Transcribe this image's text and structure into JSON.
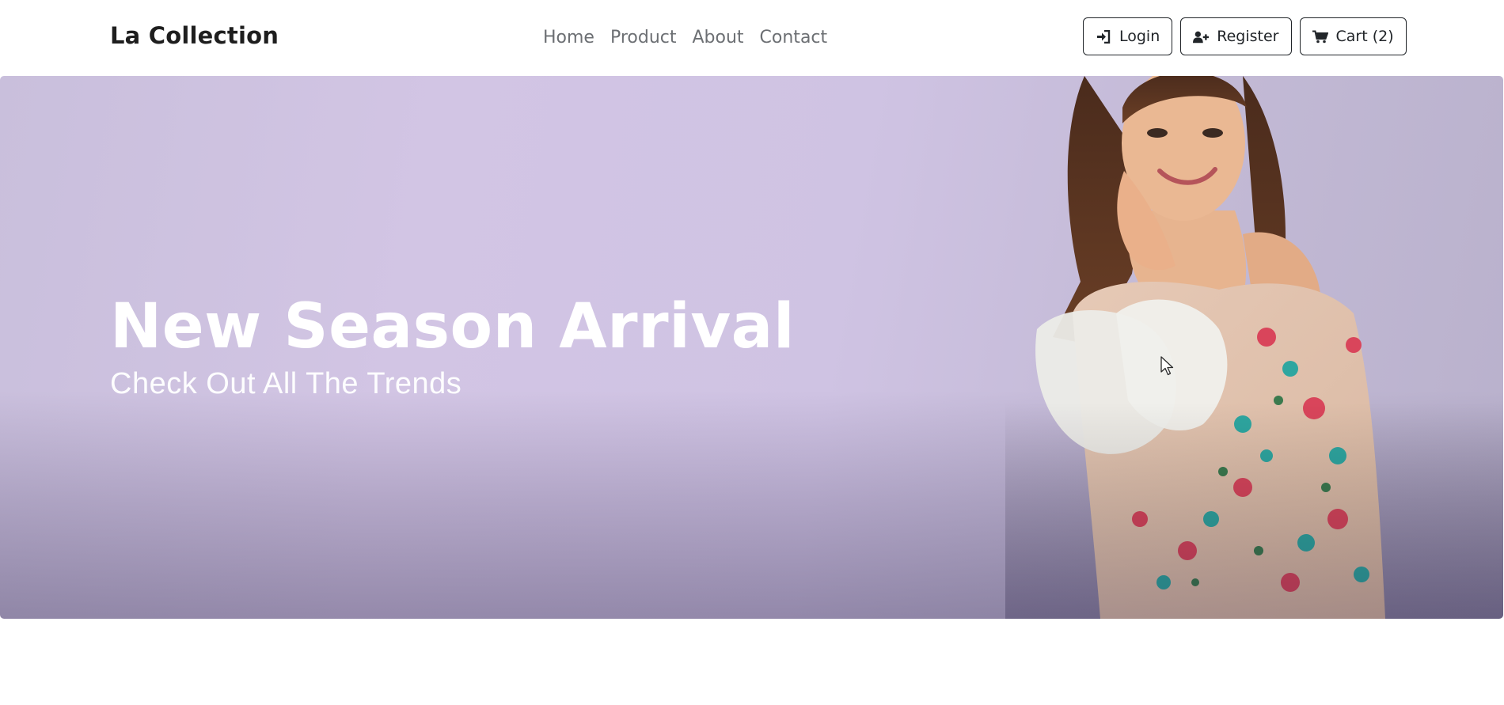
{
  "brand": {
    "name": "La Collection"
  },
  "nav": {
    "links": [
      {
        "label": "Home"
      },
      {
        "label": "Product"
      },
      {
        "label": "About"
      },
      {
        "label": "Contact"
      }
    ]
  },
  "actions": {
    "login": {
      "label": "Login",
      "icon": "sign-in-icon"
    },
    "register": {
      "label": "Register",
      "icon": "user-plus-icon"
    },
    "cart": {
      "label": "Cart (2)",
      "icon": "shopping-cart-icon"
    }
  },
  "hero": {
    "title": "New Season Arrival",
    "subtitle": "Check Out All The Trends",
    "image": "woman-in-floral-dress-photo"
  },
  "colors": {
    "text_dark": "#212529",
    "nav_link": "#6c6f73",
    "hero_lavender": "#d2c5e4",
    "hero_text": "#ffffff"
  }
}
